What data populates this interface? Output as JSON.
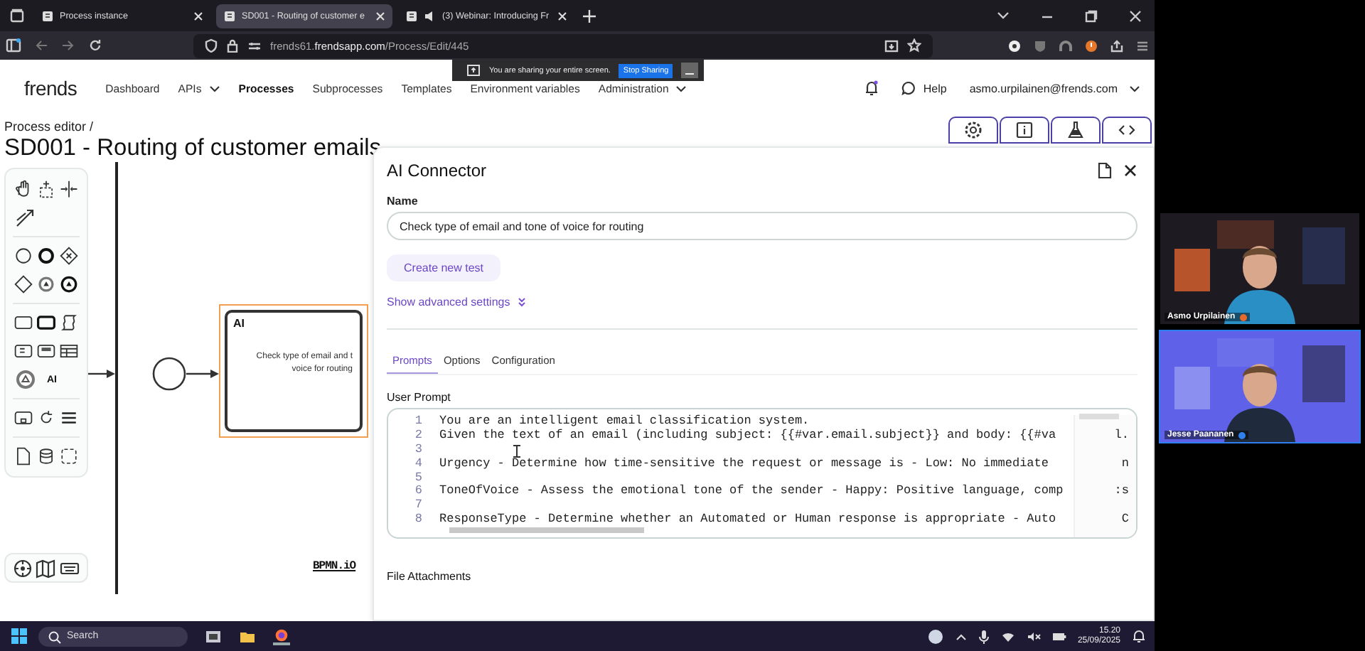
{
  "browser": {
    "tabs": [
      {
        "title": "Process instance",
        "selected": false,
        "audio": false
      },
      {
        "title": "SD001 - Routing of customer e",
        "selected": true,
        "audio": false
      },
      {
        "title": "(3) Webinar: Introducing Fr",
        "selected": false,
        "audio": true
      }
    ],
    "url": "frends61.**frendsapp.com**/Process/Edit/445"
  },
  "sharing_banner": {
    "message": "You are sharing your entire screen.",
    "button": "Stop Sharing"
  },
  "nav": {
    "logo": "frends",
    "items": [
      {
        "label": "Dashboard",
        "selected": false,
        "dropdown": false
      },
      {
        "label": "APIs",
        "selected": false,
        "dropdown": true
      },
      {
        "label": "Processes",
        "selected": true,
        "dropdown": false
      },
      {
        "label": "Subprocesses",
        "selected": false,
        "dropdown": false
      },
      {
        "label": "Templates",
        "selected": false,
        "dropdown": false
      },
      {
        "label": "Environment variables",
        "selected": false,
        "dropdown": false
      },
      {
        "label": "Administration",
        "selected": false,
        "dropdown": true
      }
    ],
    "help": "Help",
    "user": "asmo.urpilainen@frends.com"
  },
  "editor": {
    "breadcrumb": "Process editor /",
    "title": "SD001 - Routing of customer emails"
  },
  "palette": {
    "ai_label": "AI"
  },
  "canvas": {
    "task": {
      "label": "AI",
      "text_lines": [
        "Check type of email and t",
        "voice for routing"
      ],
      "selected": true
    },
    "watermark": "BPMN.iO"
  },
  "panel": {
    "title": "AI Connector",
    "name_label": "Name",
    "name_value": "Check type of email and tone of voice for routing",
    "create_test": "Create new test",
    "advanced": "Show advanced settings",
    "tabs": [
      {
        "label": "Prompts",
        "selected": true
      },
      {
        "label": "Options",
        "selected": false
      },
      {
        "label": "Configuration",
        "selected": false
      }
    ],
    "prompt_label": "User Prompt",
    "prompt_lines": [
      {
        "number": "1",
        "text": "You are an intelligent email classification system."
      },
      {
        "number": "2",
        "text": "Given the text of an email (including subject: {{#var.email.subject}} and body: {{#va",
        "tail": "l."
      },
      {
        "number": "3"
      },
      {
        "number": "4",
        "text": "Urgency - Determine how time-sensitive the request or message is - Low: No immediate",
        "tail": "n"
      },
      {
        "number": "5"
      },
      {
        "number": "6",
        "text": "ToneOfVoice - Assess the emotional tone of the sender - Happy: Positive language, comp",
        "tail": ":s"
      },
      {
        "number": "7"
      },
      {
        "number": "8",
        "text": "ResponseType - Determine whether an Automated or Human response is appropriate - Auto",
        "tail": "C"
      }
    ],
    "attachments_label": "File Attachments"
  },
  "taskbar": {
    "search_placeholder": "Search",
    "time": "15.20",
    "date": "25/09/2025"
  },
  "participants": [
    {
      "name": "Asmo Urpilainen",
      "speaking": false,
      "color": "#e8692c"
    },
    {
      "name": "Jesse Paananen",
      "speaking": true,
      "color": "#2f80ed"
    }
  ]
}
